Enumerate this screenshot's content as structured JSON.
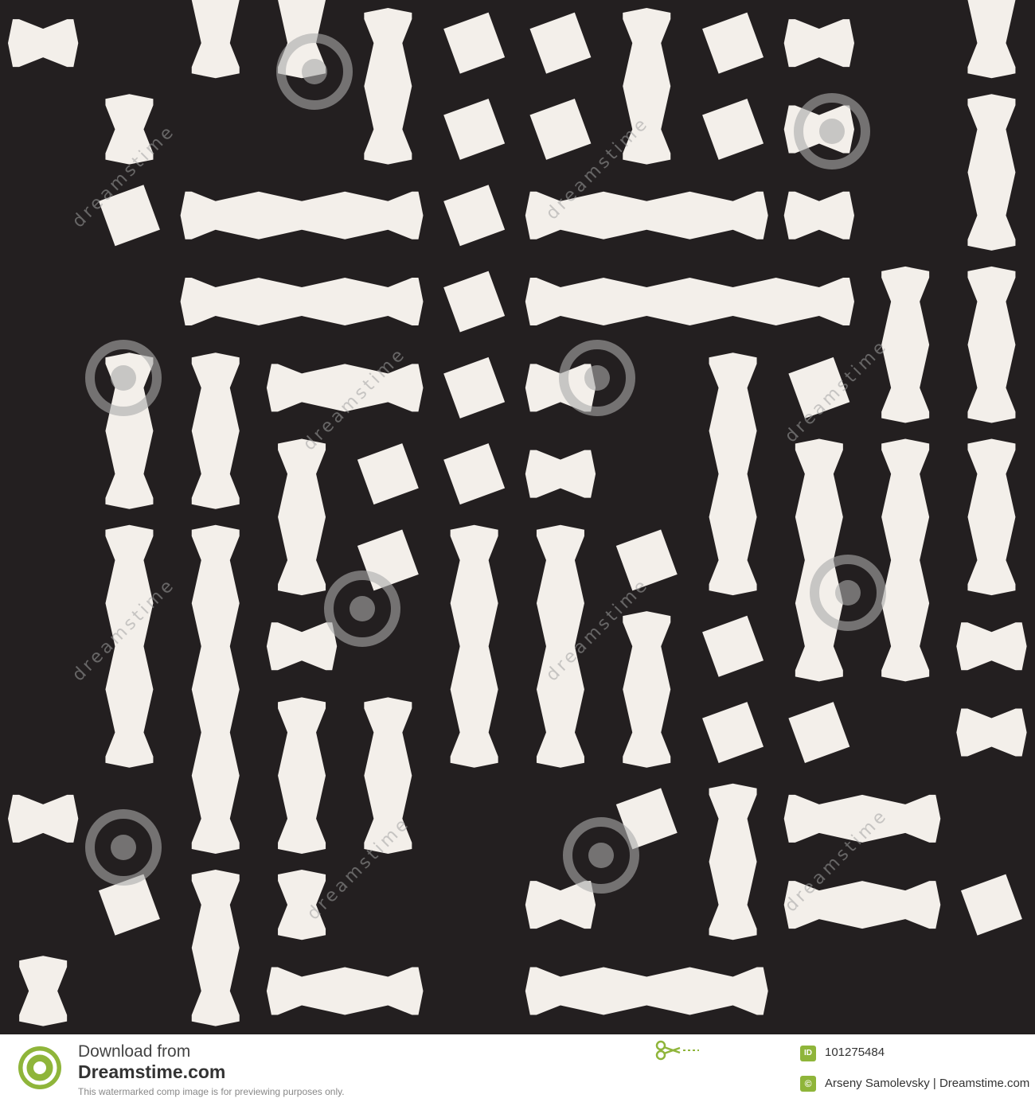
{
  "pattern": {
    "background_color": "#231f20",
    "shape_color": "#f3efea"
  },
  "watermark": {
    "text": "dreamstime",
    "icon": "spiral-logo-icon"
  },
  "footer": {
    "download_from": "Download from",
    "site": "Dreamstime.com",
    "note": "This watermarked comp image is for previewing purposes only.",
    "id_badge": "ID",
    "id_value": "101275484",
    "credit": "Arseny Samolevsky | Dreamstime.com",
    "accent_color": "#8fb53a"
  }
}
